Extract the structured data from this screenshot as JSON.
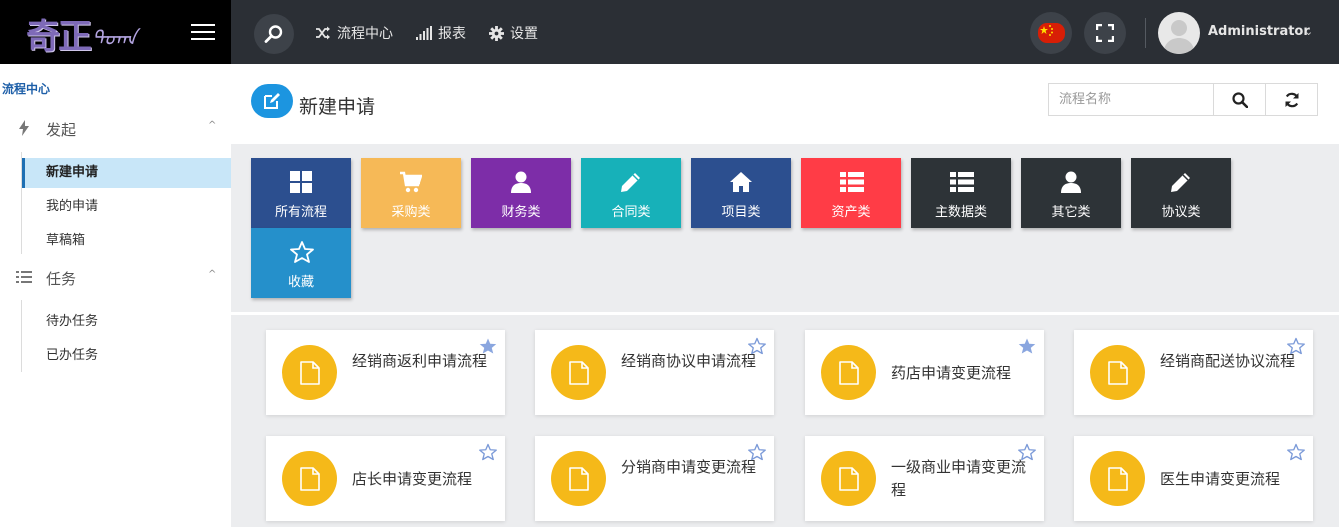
{
  "sidebar": {
    "breadcrumb": "流程中心",
    "groups": [
      {
        "label": "发起",
        "items": [
          "新建申请",
          "我的申请",
          "草稿箱"
        ]
      },
      {
        "label": "任务",
        "items": [
          "待办任务",
          "已办任务"
        ]
      }
    ],
    "active_item": "新建申请",
    "caret": "^"
  },
  "header": {
    "links": [
      {
        "label": "流程中心",
        "icon": "shuffle-icon"
      },
      {
        "label": "报表",
        "icon": "signal-bars-icon"
      },
      {
        "label": "设置",
        "icon": "gear-icon"
      }
    ],
    "user": {
      "name": "Administrator",
      "caret": "⌄"
    },
    "language_icon": "china-flag-icon"
  },
  "titlebar": {
    "title": "新建申请",
    "search_placeholder": "流程名称"
  },
  "categories": [
    {
      "label": "所有流程",
      "icon": "grid-icon",
      "color": "#2c4f8f"
    },
    {
      "label": "采购类",
      "icon": "cart-icon",
      "color": "#f6b957"
    },
    {
      "label": "财务类",
      "icon": "user-icon",
      "color": "#7d2da8"
    },
    {
      "label": "合同类",
      "icon": "pencil-icon",
      "color": "#17b1b9"
    },
    {
      "label": "项目类",
      "icon": "home-icon",
      "color": "#2c4f8f"
    },
    {
      "label": "资产类",
      "icon": "list-icon",
      "color": "#ff3c46"
    },
    {
      "label": "主数据类",
      "icon": "list-icon",
      "color": "#2d3337"
    },
    {
      "label": "其它类",
      "icon": "user-icon",
      "color": "#2d3337"
    },
    {
      "label": "协议类",
      "icon": "pencil-icon",
      "color": "#2d3337"
    },
    {
      "label": "收藏",
      "icon": "star-outline-icon",
      "color": "#2590cb"
    }
  ],
  "processes": [
    {
      "title": "经销商返利申请流程",
      "favorite": true
    },
    {
      "title": "经销商协议申请流程",
      "favorite": false
    },
    {
      "title": "药店申请变更流程",
      "favorite": true
    },
    {
      "title": "经销商配送协议流程",
      "favorite": false
    },
    {
      "title": "店长申请变更流程",
      "favorite": false
    },
    {
      "title": "分销商申请变更流程",
      "favorite": false
    },
    {
      "title": "一级商业申请变更流程",
      "favorite": false
    },
    {
      "title": "医生申请变更流程",
      "favorite": false
    }
  ],
  "colors": {
    "card_circle": "#f5b919",
    "star_filled": "#8aa6df",
    "star_outline": "#7b9ad8",
    "title_icon": "#1c95e0"
  }
}
